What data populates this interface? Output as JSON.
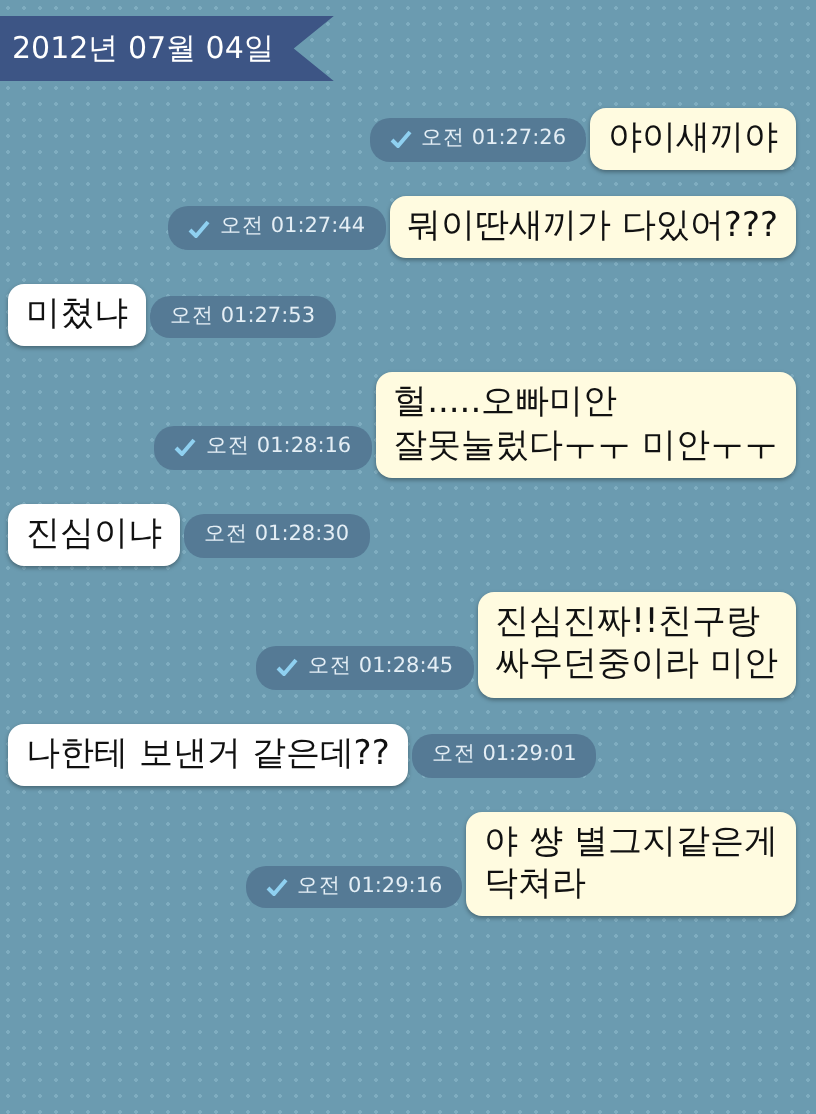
{
  "date_banner": "2012년 07월 04일",
  "messages": [
    {
      "kind": "sent",
      "text": "야이새끼야",
      "time": "오전 01:27:26",
      "read": true
    },
    {
      "kind": "sent",
      "text": "뭐이딴새끼가 다있어???",
      "time": "오전 01:27:44",
      "read": true
    },
    {
      "kind": "received",
      "text": "미쳤냐",
      "time": "오전 01:27:53"
    },
    {
      "kind": "sent",
      "text": "헐.....오빠미안\n잘못눌렀다ㅜㅜ 미안ㅜㅜ",
      "time": "오전 01:28:16",
      "read": true
    },
    {
      "kind": "received",
      "text": "진심이냐",
      "time": "오전 01:28:30"
    },
    {
      "kind": "sent",
      "text": "진심진짜!!친구랑\n싸우던중이라 미안",
      "time": "오전 01:28:45",
      "read": true
    },
    {
      "kind": "received",
      "text": "나한테 보낸거 같은데??",
      "time": "오전 01:29:01"
    },
    {
      "kind": "sent",
      "text": "야 썅 별그지같은게\n닥쳐라",
      "time": "오전 01:29:16",
      "read": true
    }
  ]
}
